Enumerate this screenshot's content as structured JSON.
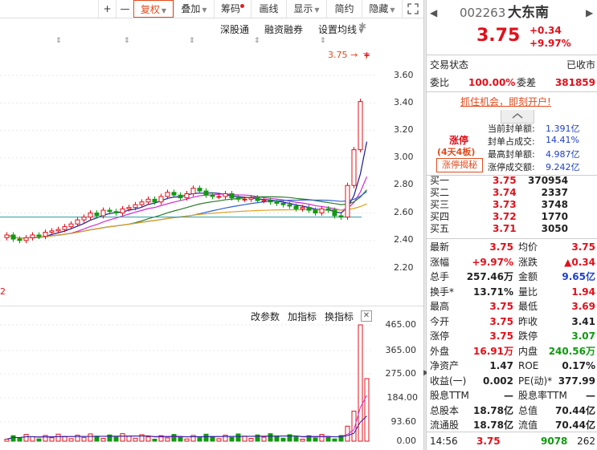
{
  "toolbar": {
    "plus": "+",
    "minus": "—",
    "fuquan": "复权",
    "diejia": "叠加",
    "chouma": "筹码",
    "huaxian": "画线",
    "xianshi": "显示",
    "jianyue": "简约",
    "yincang": "隐藏",
    "expand_icon": "expand-icon"
  },
  "subtoolbar": {
    "shengutong": "深股通",
    "rongzi": "融资融券",
    "shezhi": "设置均线"
  },
  "price_marker": "3.75",
  "price_axis": [
    "3.60",
    "3.40",
    "3.20",
    "3.00",
    "2.80",
    "2.60",
    "2.40",
    "2.20"
  ],
  "volume_toolbar": {
    "gai": "改参数",
    "jia": "加指标",
    "huan": "换指标"
  },
  "volume_axis": [
    "465.00",
    "365.00",
    "275.00",
    "184.00",
    "93.60",
    "0.00"
  ],
  "left_edge_label": "2",
  "colors": {
    "up": "#e0101a",
    "down": "#119911",
    "accent": "#e24b1e"
  },
  "quote": {
    "code": "002263",
    "name": "大东南",
    "price": "3.75",
    "change": "+0.34",
    "change_pct": "+9.97%",
    "status_label": "交易状态",
    "status_value": "已收市",
    "weibi_label": "委比",
    "weibi_value": "100.00%",
    "weicha_label": "委差",
    "weicha_value": "381859",
    "promo": "抓住机会，即刻开户!",
    "limit_title": "涨停",
    "limit_sub": "(4天4板)",
    "limit_btn": "涨停揭秘",
    "limit_stats": [
      {
        "label": "当前封单额:",
        "value": "1.391亿"
      },
      {
        "label": "封单占成交:",
        "value": "14.41%"
      },
      {
        "label": "最高封单额:",
        "value": "4.987亿"
      },
      {
        "label": "涨停成交额:",
        "value": "9.242亿"
      }
    ],
    "bids": [
      {
        "label": "买一",
        "price": "3.75",
        "vol": "370954"
      },
      {
        "label": "买二",
        "price": "3.74",
        "vol": "2337"
      },
      {
        "label": "买三",
        "price": "3.73",
        "vol": "3748"
      },
      {
        "label": "买四",
        "price": "3.72",
        "vol": "1770"
      },
      {
        "label": "买五",
        "price": "3.71",
        "vol": "3050"
      }
    ],
    "stats": [
      {
        "l1": "最新",
        "v1": "3.75",
        "c1": "red",
        "l2": "均价",
        "v2": "3.75",
        "c2": "red"
      },
      {
        "l1": "涨幅",
        "v1": "+9.97%",
        "c1": "red",
        "l2": "涨跌",
        "v2": "▲0.34",
        "c2": "red"
      },
      {
        "l1": "总手",
        "v1": "257.46万",
        "c1": "dark",
        "l2": "金额",
        "v2": "9.65亿",
        "c2": "blue"
      },
      {
        "l1": "换手*",
        "v1": "13.71%",
        "c1": "dark",
        "l2": "量比",
        "v2": "1.94",
        "c2": "red"
      },
      {
        "l1": "最高",
        "v1": "3.75",
        "c1": "red",
        "l2": "最低",
        "v2": "3.69",
        "c2": "red"
      },
      {
        "l1": "今开",
        "v1": "3.75",
        "c1": "red",
        "l2": "昨收",
        "v2": "3.41",
        "c2": "dark"
      },
      {
        "l1": "涨停",
        "v1": "3.75",
        "c1": "red",
        "l2": "跌停",
        "v2": "3.07",
        "c2": "green"
      },
      {
        "l1": "外盘",
        "v1": "16.91万",
        "c1": "red",
        "l2": "内盘",
        "v2": "240.56万",
        "c2": "green"
      },
      {
        "l1": "净资产",
        "v1": "1.47",
        "c1": "dark",
        "l2": "ROE",
        "v2": "0.17%",
        "c2": "dark"
      },
      {
        "l1": "收益(一)",
        "v1": "0.002",
        "c1": "dark",
        "l2": "PE(动)*",
        "v2": "377.99",
        "c2": "dark"
      },
      {
        "l1": "股息TTM",
        "v1": "—",
        "c1": "dark",
        "l2": "股息率TTM",
        "v2": "—",
        "c2": "dark"
      },
      {
        "l1": "总股本",
        "v1": "18.78亿",
        "c1": "dark",
        "l2": "总值",
        "v2": "70.44亿",
        "c2": "dark"
      },
      {
        "l1": "流通股",
        "v1": "18.78亿",
        "c1": "dark",
        "l2": "流值",
        "v2": "70.44亿",
        "c2": "dark"
      }
    ],
    "tick": {
      "time": "14:56",
      "price": "3.75",
      "vol": "9078",
      "num": "262"
    }
  }
}
